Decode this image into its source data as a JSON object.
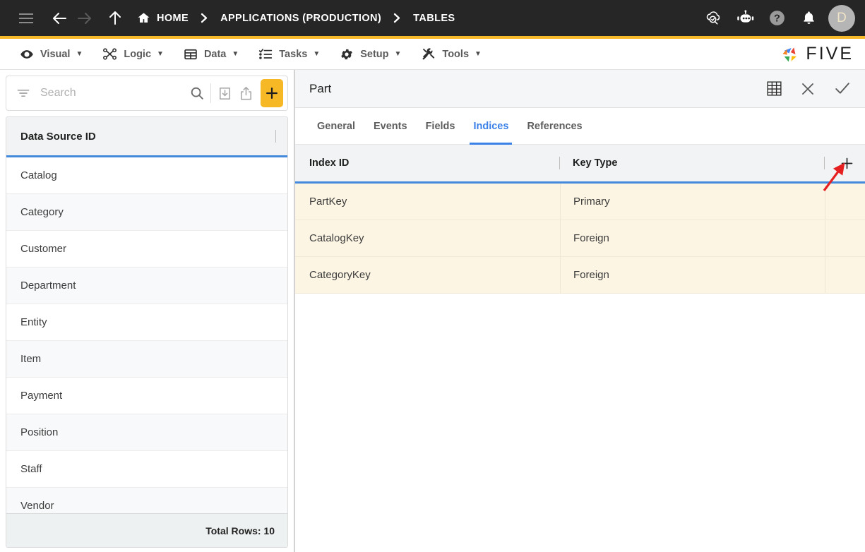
{
  "topbar": {
    "menu_icon": "hamburger-icon",
    "back_icon": "arrow-left-icon",
    "forward_icon": "arrow-right-icon",
    "up_icon": "arrow-up-icon",
    "breadcrumbs": [
      {
        "label": "HOME",
        "icon": "home-icon"
      },
      {
        "label": "APPLICATIONS (PRODUCTION)",
        "icon": ""
      },
      {
        "label": "TABLES",
        "icon": ""
      }
    ],
    "separator": "›",
    "right_icons": [
      "cloud-check-icon",
      "chatbot-icon",
      "help-icon",
      "bell-icon"
    ],
    "avatar_initial": "D",
    "accent_color": "#F5B92B",
    "background_color": "#262626"
  },
  "menubar": {
    "items": [
      {
        "label": "Visual",
        "icon": "eye-icon",
        "caret": "▼"
      },
      {
        "label": "Logic",
        "icon": "logic-nodes-icon",
        "caret": "▼"
      },
      {
        "label": "Data",
        "icon": "table-grid-icon",
        "caret": "▼"
      },
      {
        "label": "Tasks",
        "icon": "checklist-icon",
        "caret": "▼"
      },
      {
        "label": "Setup",
        "icon": "gear-icon",
        "caret": "▼"
      },
      {
        "label": "Tools",
        "icon": "tools-icon",
        "caret": "▼"
      }
    ],
    "logo_text": "FIVE"
  },
  "sidebar": {
    "search": {
      "placeholder": "Search",
      "value": "",
      "filter_icon": "filter-icon",
      "search_icon": "search-icon",
      "import_icon": "import-download-icon",
      "export_icon": "export-share-icon",
      "add_label": "+"
    },
    "column_header": "Data Source ID",
    "items": [
      {
        "label": "Catalog"
      },
      {
        "label": "Category"
      },
      {
        "label": "Customer"
      },
      {
        "label": "Department"
      },
      {
        "label": "Entity"
      },
      {
        "label": "Item"
      },
      {
        "label": "Payment"
      },
      {
        "label": "Position"
      },
      {
        "label": "Staff"
      },
      {
        "label": "Vendor"
      }
    ],
    "footer": "Total Rows: 10"
  },
  "detail": {
    "title": "Part",
    "actions": [
      {
        "name": "grid-view-icon"
      },
      {
        "name": "close-icon"
      },
      {
        "name": "confirm-check-icon"
      }
    ],
    "tabs": [
      {
        "label": "General",
        "active": false
      },
      {
        "label": "Events",
        "active": false
      },
      {
        "label": "Fields",
        "active": false
      },
      {
        "label": "Indices",
        "active": true
      },
      {
        "label": "References",
        "active": false
      }
    ],
    "grid": {
      "columns": [
        "Index ID",
        "Key Type"
      ],
      "add_button": "+",
      "rows": [
        {
          "index_id": "PartKey",
          "key_type": "Primary"
        },
        {
          "index_id": "CatalogKey",
          "key_type": "Foreign"
        },
        {
          "index_id": "CategoryKey",
          "key_type": "Foreign"
        }
      ],
      "row_background": "#FDF5E3",
      "header_underline_color": "#4389DC"
    }
  },
  "annotation": {
    "arrow_color": "#E62020",
    "points_to": "add-index-button"
  }
}
